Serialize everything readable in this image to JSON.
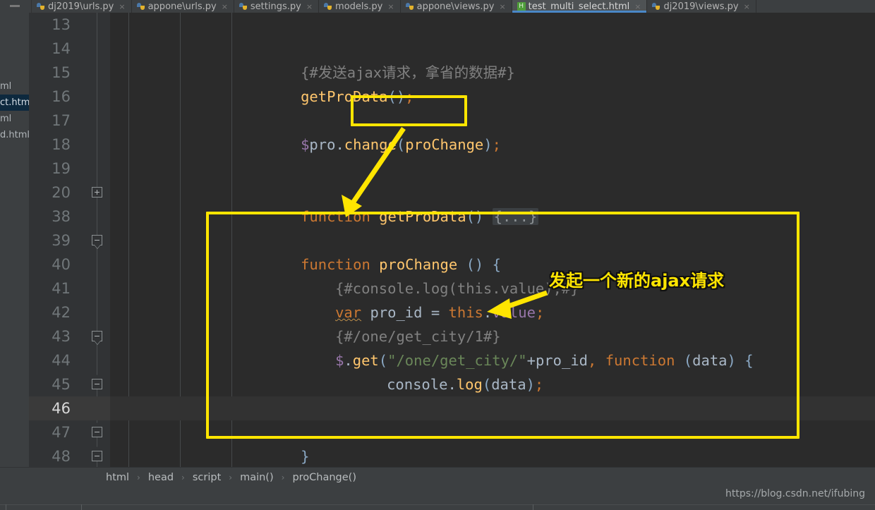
{
  "tabs": [
    {
      "label": "dj2019\\urls.py",
      "icon": "python-file-icon",
      "active": false,
      "close": "×"
    },
    {
      "label": "appone\\urls.py",
      "icon": "python-file-icon",
      "active": false,
      "close": "×"
    },
    {
      "label": "settings.py",
      "icon": "python-file-icon",
      "active": false,
      "close": "×"
    },
    {
      "label": "models.py",
      "icon": "python-file-icon",
      "active": false,
      "close": "×"
    },
    {
      "label": "appone\\views.py",
      "icon": "python-file-icon",
      "active": false,
      "close": "×"
    },
    {
      "label": "test_multi_select.html",
      "icon": "html-file-icon",
      "active": true,
      "close": "×",
      "badge": "H"
    },
    {
      "label": "dj2019\\views.py",
      "icon": "python-file-icon",
      "active": false,
      "close": "×"
    }
  ],
  "file_tree": [
    {
      "label": "ml"
    },
    {
      "label": "ct.htm",
      "selected": true
    },
    {
      "label": "ml"
    },
    {
      "label": "d.html"
    }
  ],
  "gutter": {
    "lines": [
      {
        "num": "13",
        "fold": "none",
        "current": false
      },
      {
        "num": "14",
        "fold": "none",
        "current": false
      },
      {
        "num": "15",
        "fold": "none",
        "current": false
      },
      {
        "num": "16",
        "fold": "none",
        "current": false
      },
      {
        "num": "17",
        "fold": "none",
        "current": false
      },
      {
        "num": "18",
        "fold": "none",
        "current": false
      },
      {
        "num": "19",
        "fold": "none",
        "current": false
      },
      {
        "num": "20",
        "fold": "plus",
        "current": false
      },
      {
        "num": "38",
        "fold": "none",
        "current": false
      },
      {
        "num": "39",
        "fold": "minus-down",
        "current": false
      },
      {
        "num": "40",
        "fold": "none",
        "current": false
      },
      {
        "num": "41",
        "fold": "none",
        "current": false
      },
      {
        "num": "42",
        "fold": "none",
        "current": false
      },
      {
        "num": "43",
        "fold": "minus-down",
        "current": false
      },
      {
        "num": "44",
        "fold": "none",
        "current": false
      },
      {
        "num": "45",
        "fold": "minus-up",
        "current": false
      },
      {
        "num": "46",
        "fold": "none",
        "current": true
      },
      {
        "num": "47",
        "fold": "minus-up",
        "current": false
      },
      {
        "num": "48",
        "fold": "minus-up",
        "current": false
      }
    ]
  },
  "code": {
    "lines": [
      "",
      "{#发送ajax请求，拿省的数据#}",
      "getProData();",
      "",
      "$pro.change(proChange);",
      "",
      "",
      "function getProData() {...}",
      "",
      "function proChange () {",
      "    {#console.log(this.value);#}",
      "    var pro_id = this.value;",
      "    {#/one/get_city/1#}",
      "    $.get(\"/one/get_city/\"+pro_id, function (data) {",
      "        console.log(data);",
      "    });",
      "",
      "    }",
      "}"
    ]
  },
  "annotations": {
    "highlight_box_call": "proChange",
    "highlight_box_function": "function proChange () { ... }",
    "label_ajax": "发起一个新的ajax请求"
  },
  "breadcrumb": {
    "items": [
      "html",
      "head",
      "script",
      "main()",
      "proChange()"
    ],
    "separator": "›"
  },
  "statusbar": {
    "watermark": "https://blog.csdn.net/ifubing"
  },
  "colors": {
    "editor_bg": "#2b2b2b",
    "gutter_bg": "#313335",
    "chrome_bg": "#3c3f41",
    "active_tab_bg": "#4e5254",
    "tab_underline": "#4a88c7",
    "annotation": "#ffe500",
    "selection": "#0d293e",
    "keyword": "#cc7832",
    "function": "#ffc66d",
    "string": "#6a8759",
    "comment": "#808080",
    "field": "#9876aa",
    "text": "#a9b7c6"
  }
}
